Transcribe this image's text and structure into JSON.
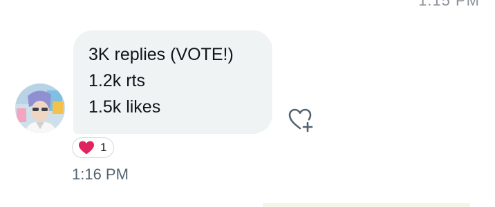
{
  "top_cropped_timestamp": "1:15 PM",
  "message": {
    "lines": [
      "3K replies (VOTE!)",
      "1.2k rts",
      "1.5k likes"
    ]
  },
  "reaction": {
    "icon": "heart-emoji",
    "count": "1",
    "color": "#e0245e"
  },
  "add_reaction_icon": "heart-plus-icon",
  "timestamp": "1:16 PM"
}
